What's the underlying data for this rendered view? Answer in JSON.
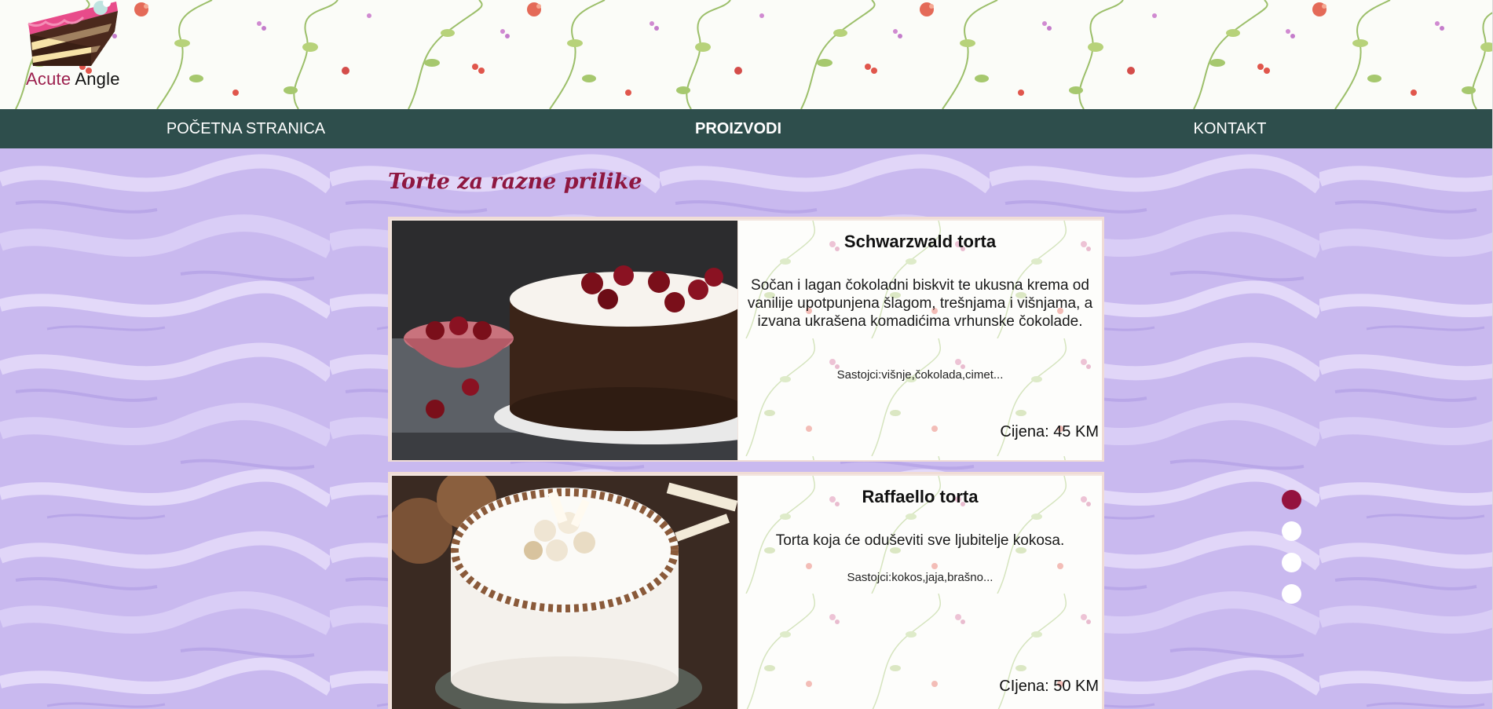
{
  "brand": {
    "name_part1": "Acute",
    "name_part2": "Angle"
  },
  "nav": {
    "items": [
      {
        "label": "POČETNA STRANICA"
      },
      {
        "label": "PROIZVODI"
      },
      {
        "label": "KONTAKT"
      }
    ],
    "active": "PROIZVODI"
  },
  "section": {
    "title": "Torte za razne prilike"
  },
  "products": [
    {
      "name": "Schwarzwald torta",
      "description": "Sočan i lagan čokoladni biskvit te ukusna krema od vanilije upotpunjena šlagom, trešnjama i višnjama, a izvana ukrašena komadićima vrhunske čokolade.",
      "ingredients": "Sastojci:višnje,čokolada,cimet...",
      "price": "Cijena: 45 KM"
    },
    {
      "name": "Raffaello torta",
      "description": "Torta koja će oduševiti sve ljubitelje kokosa.",
      "ingredients": "Sastojci:kokos,jaja,brašno...",
      "price": "CIjena: 50 KM"
    }
  ],
  "carousel": {
    "total": 4,
    "active_index": 1
  },
  "colors": {
    "nav_background": "#2e4e4c",
    "accent": "#94123f",
    "title": "#8e1740",
    "frosting": "#c9b9ef"
  }
}
